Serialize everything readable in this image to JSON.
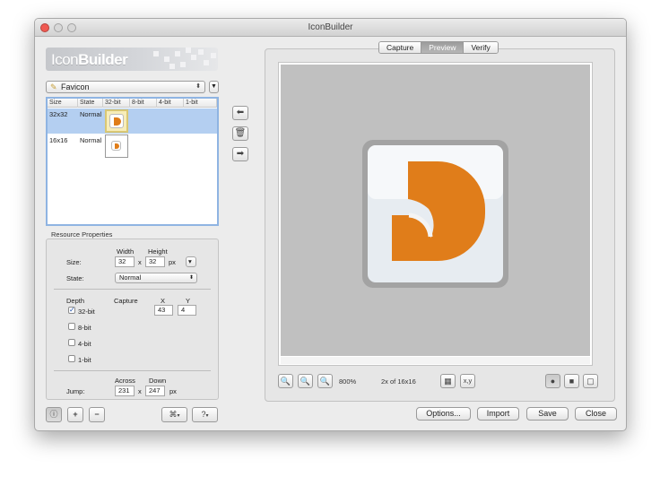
{
  "window": {
    "title": "IconBuilder"
  },
  "logo": {
    "text_light": "Icon",
    "text_bold": "Builder"
  },
  "resource_popup": {
    "selected": "Favicon"
  },
  "table": {
    "columns": [
      "Size",
      "State",
      "32-bit",
      "8-bit",
      "4-bit",
      "1-bit"
    ],
    "rows": [
      {
        "size": "32x32",
        "state": "Normal",
        "selected": true
      },
      {
        "size": "16x16",
        "state": "Normal",
        "selected": false
      }
    ]
  },
  "properties": {
    "title": "Resource Properties",
    "size_label": "Size:",
    "width_label": "Width",
    "height_label": "Height",
    "width_value": "32",
    "height_value": "32",
    "times": "x",
    "px": "px",
    "state_label": "State:",
    "state_value": "Normal",
    "depth_label": "Depth",
    "capture_label": "Capture",
    "x_label": "X",
    "y_label": "Y",
    "depths": [
      {
        "label": "32-bit",
        "checked": true
      },
      {
        "label": "8-bit",
        "checked": false
      },
      {
        "label": "4-bit",
        "checked": false
      },
      {
        "label": "1-bit",
        "checked": false
      }
    ],
    "capture_x": "43",
    "capture_y": "4",
    "jump_label": "Jump:",
    "across_label": "Across",
    "down_label": "Down",
    "across_value": "231",
    "down_value": "247"
  },
  "tabs": [
    {
      "label": "Capture",
      "active": false
    },
    {
      "label": "Preview",
      "active": true
    },
    {
      "label": "Verify",
      "active": false
    }
  ],
  "zoom": {
    "level": "800%",
    "info": "2x of 16x16",
    "xy_label": "x,y"
  },
  "buttons": {
    "options": "Options...",
    "import": "Import",
    "save": "Save",
    "close": "Close"
  },
  "colors": {
    "accent_orange": "#e07d1a",
    "selection_blue": "#b4cff1",
    "canvas_gray": "#c0c0c0"
  }
}
